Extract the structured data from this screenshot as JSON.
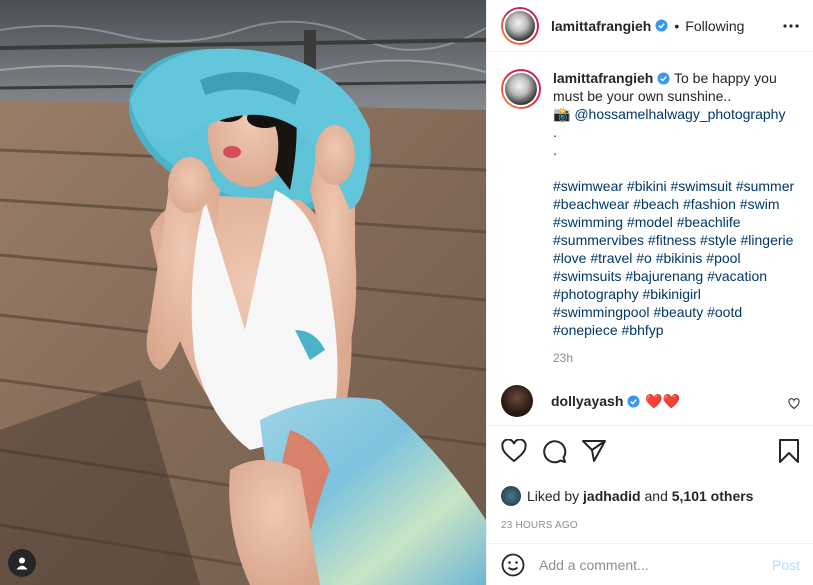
{
  "header": {
    "username": "lamittafrangieh",
    "separator": "•",
    "follow_status": "Following",
    "more_icon": "more-horizontal-icon"
  },
  "caption": {
    "username": "lamittafrangieh",
    "text": "To be happy you must be your own sunshine..",
    "credit_symbol": "📸",
    "mention": "@hossamelhalwagy_photography",
    "dot1": ".",
    "dot2": ".",
    "hashtags": "#swimwear #bikini #swimsuit #summer #beachwear #beach #fashion #swim #swimming #model #beachlife #summervibes #fitness #style #lingerie #love #travel #o #bikinis #pool #swimsuits #bajurenang #vacation #photography #bikinigirl #swimmingpool #beauty #ootd #onepiece #bhfyp",
    "time": "23h"
  },
  "reply": {
    "username": "dollyayash",
    "text": "❤️❤️"
  },
  "likes": {
    "prefix": "Liked by",
    "user": "jadhadid",
    "and": "and",
    "count": "5,101 others"
  },
  "posted_ago": "23 HOURS AGO",
  "comment_box": {
    "placeholder": "Add a comment...",
    "post_label": "Post"
  },
  "colors": {
    "link": "#00376b",
    "secondary": "#8e8e8e",
    "verified": "#3897f0",
    "post_disabled": "#b2dffc"
  }
}
